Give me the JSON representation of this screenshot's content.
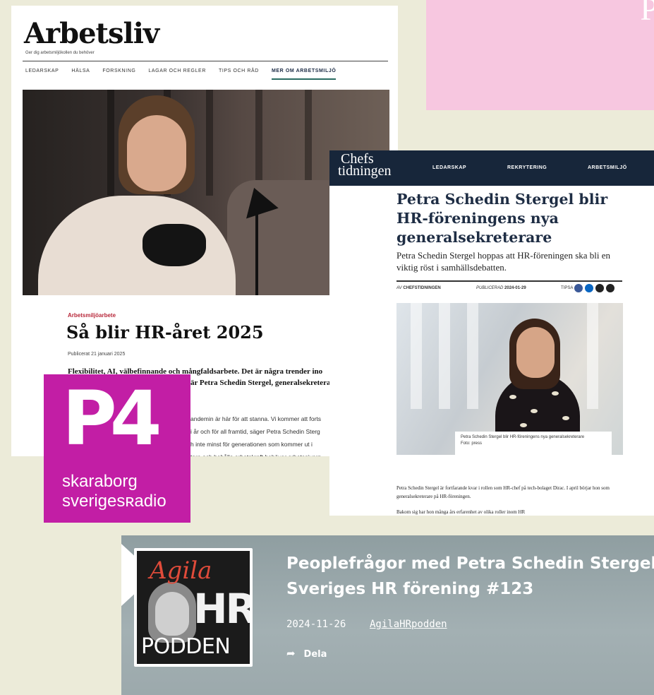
{
  "pink_card": {
    "glyph": "P"
  },
  "arbetsliv": {
    "logo": "Arbetsliv",
    "tagline": "Ger dig arbetsmiljökollen du behöver",
    "nav": [
      "LEDARSKAP",
      "HÄLSA",
      "FORSKNING",
      "LAGAR OCH REGLER",
      "TIPS OCH RÅD",
      "MER OM ARBETSMILJÖ"
    ],
    "kicker": "Arbetsmiljöarbete",
    "headline": "Så blir HR-året 2025",
    "published": "Publicerat 21 januari 2025",
    "lead_1": "Flexibilitet, AI, välbefinnande och mångfaldsarbete. Det är några trender ino",
    "lead_2": "är Petra Schedin Stergel, generalsekreterar",
    "body_1": "andemin är här för att stanna. Vi kommer att forts",
    "body_2": "i år och för all framtid, säger Petra Schedin Sterg",
    "body_3": "h inte minst för generationen som kommer ut i",
    "body_4": "tare och behålla arbetskraft behöver arbetsgivarn"
  },
  "p4": {
    "logo": "P4",
    "line1": "skaraborg",
    "line2": "sverigesʀadio",
    "color": "#c21ea5"
  },
  "chefs": {
    "brand_1": "Chefs",
    "brand_2": "tidningen",
    "nav": [
      "LEDARSKAP",
      "REKRYTERING",
      "ARBETSMILJÖ"
    ],
    "headline": "Petra Schedin Stergel blir HR-föreningens nya generalsekreterare",
    "subhead": "Petra Schedin Stergel hoppas att HR-föreningen ska bli en viktig röst i samhällsdebatten.",
    "by_label": "AV",
    "by_value": "CHEFSTIDNINGEN",
    "pub_label": "PUBLICERAD",
    "pub_value": "2024-01-29",
    "tips_label": "TIPSA",
    "caption_1": "Petra Schedin Stergel blir HR-föreningens nya generalsekreterare",
    "caption_2": "Foto: press",
    "body_1": "Petra Schedin Stergel är fortfarande kvar i rollen som HR-chef på tech-bolaget Dirac. I april börjar hon som generalsekreterare på HR-föreningen.",
    "body_2": "Bakom sig har hon många års erfarenhet av olika roller inom HR",
    "social_colors": [
      "#3b5998",
      "#0a66c2",
      "#222222",
      "#222222"
    ]
  },
  "podcast": {
    "cover_top": "Agila",
    "cover_mid": "HR",
    "cover_bottom": "PODDEN",
    "title_1": "Peoplefrågor med Petra Schedin Stergel-",
    "title_2": "Sveriges HR förening #123",
    "date": "2024-11-26",
    "channel": "AgilaHRpodden",
    "share_label": "Dela"
  }
}
